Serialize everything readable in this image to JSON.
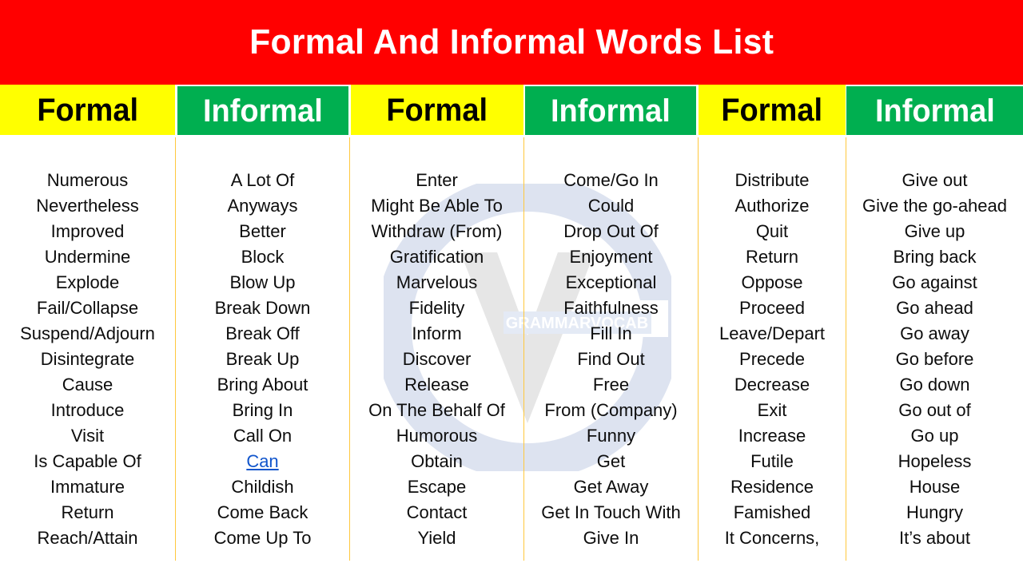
{
  "title": "Formal And Informal Words List",
  "colors": {
    "title_bar": "#FF0000",
    "title_text": "#FFFFFF",
    "formal_header_bg": "#FFFF00",
    "formal_header_text": "#000000",
    "informal_header_bg": "#00AF50",
    "informal_header_text": "#FFFFFF",
    "divider": "#FFC83D",
    "body_text": "#0D0D0D",
    "hyperlink": "#1155CC",
    "watermark_ring": "#DDE3F0",
    "watermark_v": "#E3E3E3"
  },
  "watermark": {
    "label": "GRAMMARVOCAB"
  },
  "headers": [
    {
      "label": "Formal",
      "kind": "formal"
    },
    {
      "label": "Informal",
      "kind": "informal"
    },
    {
      "label": "Formal",
      "kind": "formal"
    },
    {
      "label": "Informal",
      "kind": "informal"
    },
    {
      "label": "Formal",
      "kind": "formal"
    },
    {
      "label": "Informal",
      "kind": "informal"
    }
  ],
  "columns": [
    {
      "header": "Formal",
      "words": [
        "Numerous",
        "Nevertheless",
        "Improved",
        "Undermine",
        "Explode",
        "Fail/Collapse",
        "Suspend/Adjourn",
        "Disintegrate",
        "Cause",
        "Introduce",
        "Visit",
        "Is Capable Of",
        "Immature",
        "Return",
        "Reach/Attain"
      ]
    },
    {
      "header": "Informal",
      "words": [
        "A Lot Of",
        "Anyways",
        "Better",
        "Block",
        "Blow Up",
        "Break Down",
        "Break Off",
        "Break Up",
        "Bring About",
        "Bring In",
        "Call On",
        "Can",
        "Childish",
        "Come Back",
        "Come Up To"
      ],
      "link_index": 11
    },
    {
      "header": "Formal",
      "words": [
        "Enter",
        "Might Be Able To",
        "Withdraw (From)",
        "Gratification",
        "Marvelous",
        "Fidelity",
        "Inform",
        "Discover",
        "Release",
        "On The Behalf Of",
        "Humorous",
        "Obtain",
        "Escape",
        "Contact",
        "Yield"
      ]
    },
    {
      "header": "Informal",
      "words": [
        "Come/Go In",
        "Could",
        "Drop Out Of",
        "Enjoyment",
        "Exceptional",
        "Faithfulness",
        "Fill In",
        "Find Out",
        "Free",
        "From (Company)",
        "Funny",
        "Get",
        "Get Away",
        "Get In Touch With",
        "Give In"
      ]
    },
    {
      "header": "Formal",
      "words": [
        "Distribute",
        "Authorize",
        "Quit",
        "Return",
        "Oppose",
        "Proceed",
        "Leave/Depart",
        "Precede",
        "Decrease",
        "Exit",
        "Increase",
        "Futile",
        "Residence",
        "Famished",
        "It Concerns,"
      ]
    },
    {
      "header": "Informal",
      "words": [
        "Give out",
        "Give the go-ahead",
        "Give up",
        "Bring back",
        "Go against",
        "Go ahead",
        "Go away",
        "Go before",
        "Go down",
        "Go out of",
        "Go up",
        "Hopeless",
        "House",
        "Hungry",
        "It’s about"
      ]
    }
  ]
}
